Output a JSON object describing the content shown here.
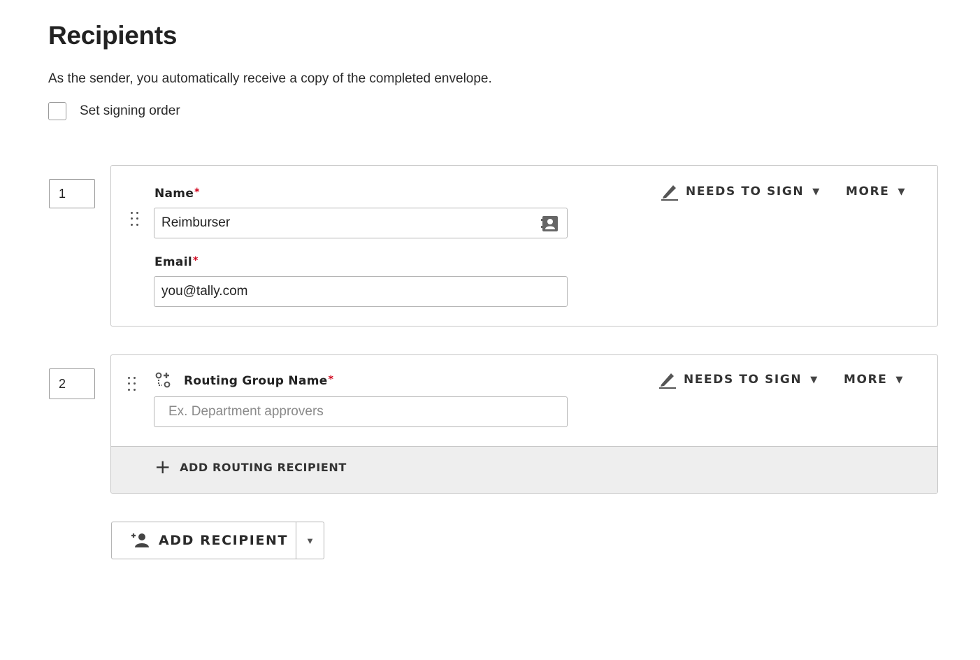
{
  "page": {
    "title": "Recipients",
    "subtitle": "As the sender, you automatically receive a copy of the completed envelope.",
    "signing_order_label": "Set signing order",
    "signing_order_checked": false
  },
  "recipients": [
    {
      "order": "1",
      "name_label": "Name",
      "name_value": "Reimburser",
      "email_label": "Email",
      "email_value": "you@tally.com",
      "required_mark": "*",
      "action_label": "NEEDS TO SIGN",
      "more_label": "MORE"
    },
    {
      "order": "2",
      "routing_label": "Routing Group Name",
      "routing_placeholder": "Ex. Department approvers",
      "required_mark": "*",
      "action_label": "NEEDS TO SIGN",
      "more_label": "MORE",
      "add_routing_label": "ADD ROUTING RECIPIENT",
      "add_routing_icon": "+"
    }
  ],
  "add_recipient": {
    "label": "ADD RECIPIENT",
    "caret": "▼"
  },
  "icons": {
    "caret": "▼",
    "accent_required": "#d0021b"
  }
}
